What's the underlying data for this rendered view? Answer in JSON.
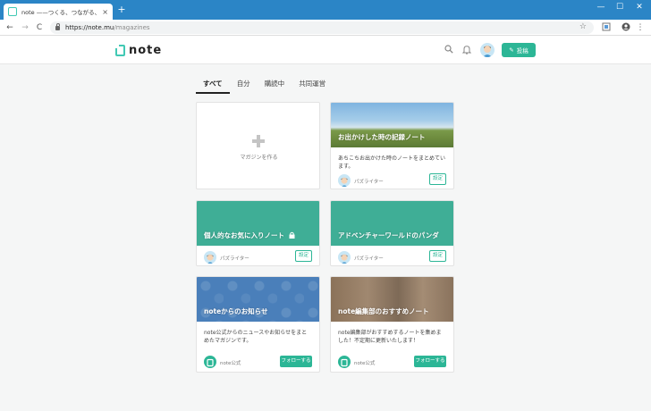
{
  "browser": {
    "tab_title": "note ——つくる、つながる、とどける。",
    "tab_close": "×",
    "new_tab": "+",
    "url_host": "https://note.mu",
    "url_path": "/magazines",
    "back": "←",
    "forward": "→",
    "reload": "C",
    "star": "☆",
    "minimize": "—",
    "maximize": "☐",
    "close": "✕",
    "menu": "⋮"
  },
  "header": {
    "logo_text": "note",
    "post_label": "投稿",
    "post_icon": "✎"
  },
  "tabs": [
    {
      "label": "すべて",
      "active": true
    },
    {
      "label": "自分",
      "active": false
    },
    {
      "label": "購読中",
      "active": false
    },
    {
      "label": "共同運営",
      "active": false
    }
  ],
  "create_card": {
    "label": "マガジンを作る"
  },
  "cards": [
    {
      "title": "お出かけした時の記録ノート",
      "description": "あちこちお出かけた時のノートをまとめています。",
      "user": "パズライター",
      "action": "設定"
    },
    {
      "title": "個人的なお気に入りノート",
      "description": "",
      "user": "パズライター",
      "action": "設定"
    },
    {
      "title": "アドベンチャーワールドのパンダ",
      "description": "",
      "user": "パズライター",
      "action": "設定"
    },
    {
      "title": "noteからのお知らせ",
      "description": "note公式からのニュースやお知らせをまとめたマガジンです。",
      "user": "note公式",
      "action": "フォローする"
    },
    {
      "title": "note編集部のおすすめノート",
      "description": "note編集部がおすすめするノートを集めました！不定期に更新いたします！",
      "user": "note公式",
      "action": "フォローする"
    }
  ],
  "colors": {
    "titlebar": "#2b85c6",
    "accent": "#2cb696",
    "teal_card": "#3fae96"
  }
}
